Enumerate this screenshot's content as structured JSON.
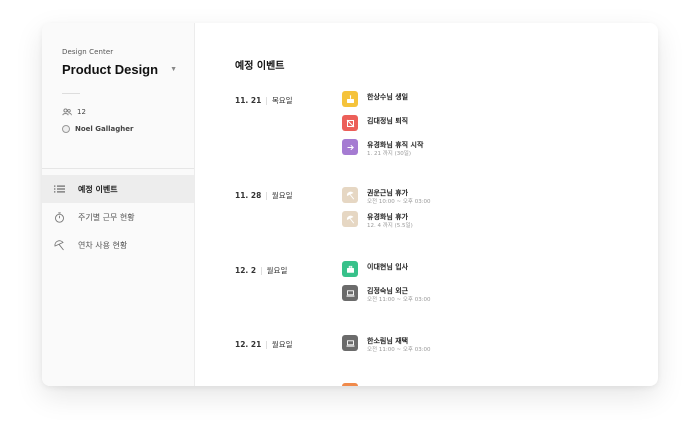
{
  "sidebar": {
    "team_subtitle": "Design Center",
    "team_title": "Product Design",
    "member_count": "12",
    "owner_name": "Noel Gallagher",
    "nav": [
      {
        "label": "예정 이벤트",
        "icon": "list-icon",
        "active": true
      },
      {
        "label": "주기별 근무 현황",
        "icon": "stopwatch-icon",
        "active": false
      },
      {
        "label": "연차 사용 현황",
        "icon": "umbrella-icon",
        "active": false
      }
    ]
  },
  "main": {
    "page_title": "예정 이벤트",
    "days": [
      {
        "date": "11. 21",
        "weekday": "목요일",
        "events": [
          {
            "title": "한상수님 생일",
            "sub": "",
            "icon": "cake-icon",
            "color": "#f5c33b"
          },
          {
            "title": "김대정님 퇴직",
            "sub": "",
            "icon": "door-exit-icon",
            "color": "#ec5f59"
          },
          {
            "title": "유경화님 휴직 시작",
            "sub": "1. 21 까지 (30일)",
            "icon": "arrow-right-icon",
            "color": "#a57bd2"
          }
        ]
      },
      {
        "date": "11. 28",
        "weekday": "월요일",
        "events": [
          {
            "title": "권운근님 휴가",
            "sub": "오전 10:00 ~ 오후 03:00",
            "icon": "umbrella-icon",
            "color": "#e6d7c3"
          },
          {
            "title": "유경화님 휴가",
            "sub": "12. 4 까지 (5.5일)",
            "icon": "umbrella-icon",
            "color": "#e6d7c3"
          }
        ]
      },
      {
        "date": "12. 2",
        "weekday": "월요일",
        "events": [
          {
            "title": "이대현님 입사",
            "sub": "",
            "icon": "briefcase-icon",
            "color": "#37c18a"
          },
          {
            "title": "김정숙님 외근",
            "sub": "오전 11:00 ~ 오후 03:00",
            "icon": "laptop-icon",
            "color": "#6b6b6b"
          }
        ]
      },
      {
        "date": "12. 21",
        "weekday": "월요일",
        "events": [
          {
            "title": "한소림님 재택",
            "sub": "오전 11:00 ~ 오후 03:00",
            "icon": "laptop-icon",
            "color": "#6b6b6b"
          }
        ]
      }
    ],
    "peek_color": "#f08a4b"
  }
}
